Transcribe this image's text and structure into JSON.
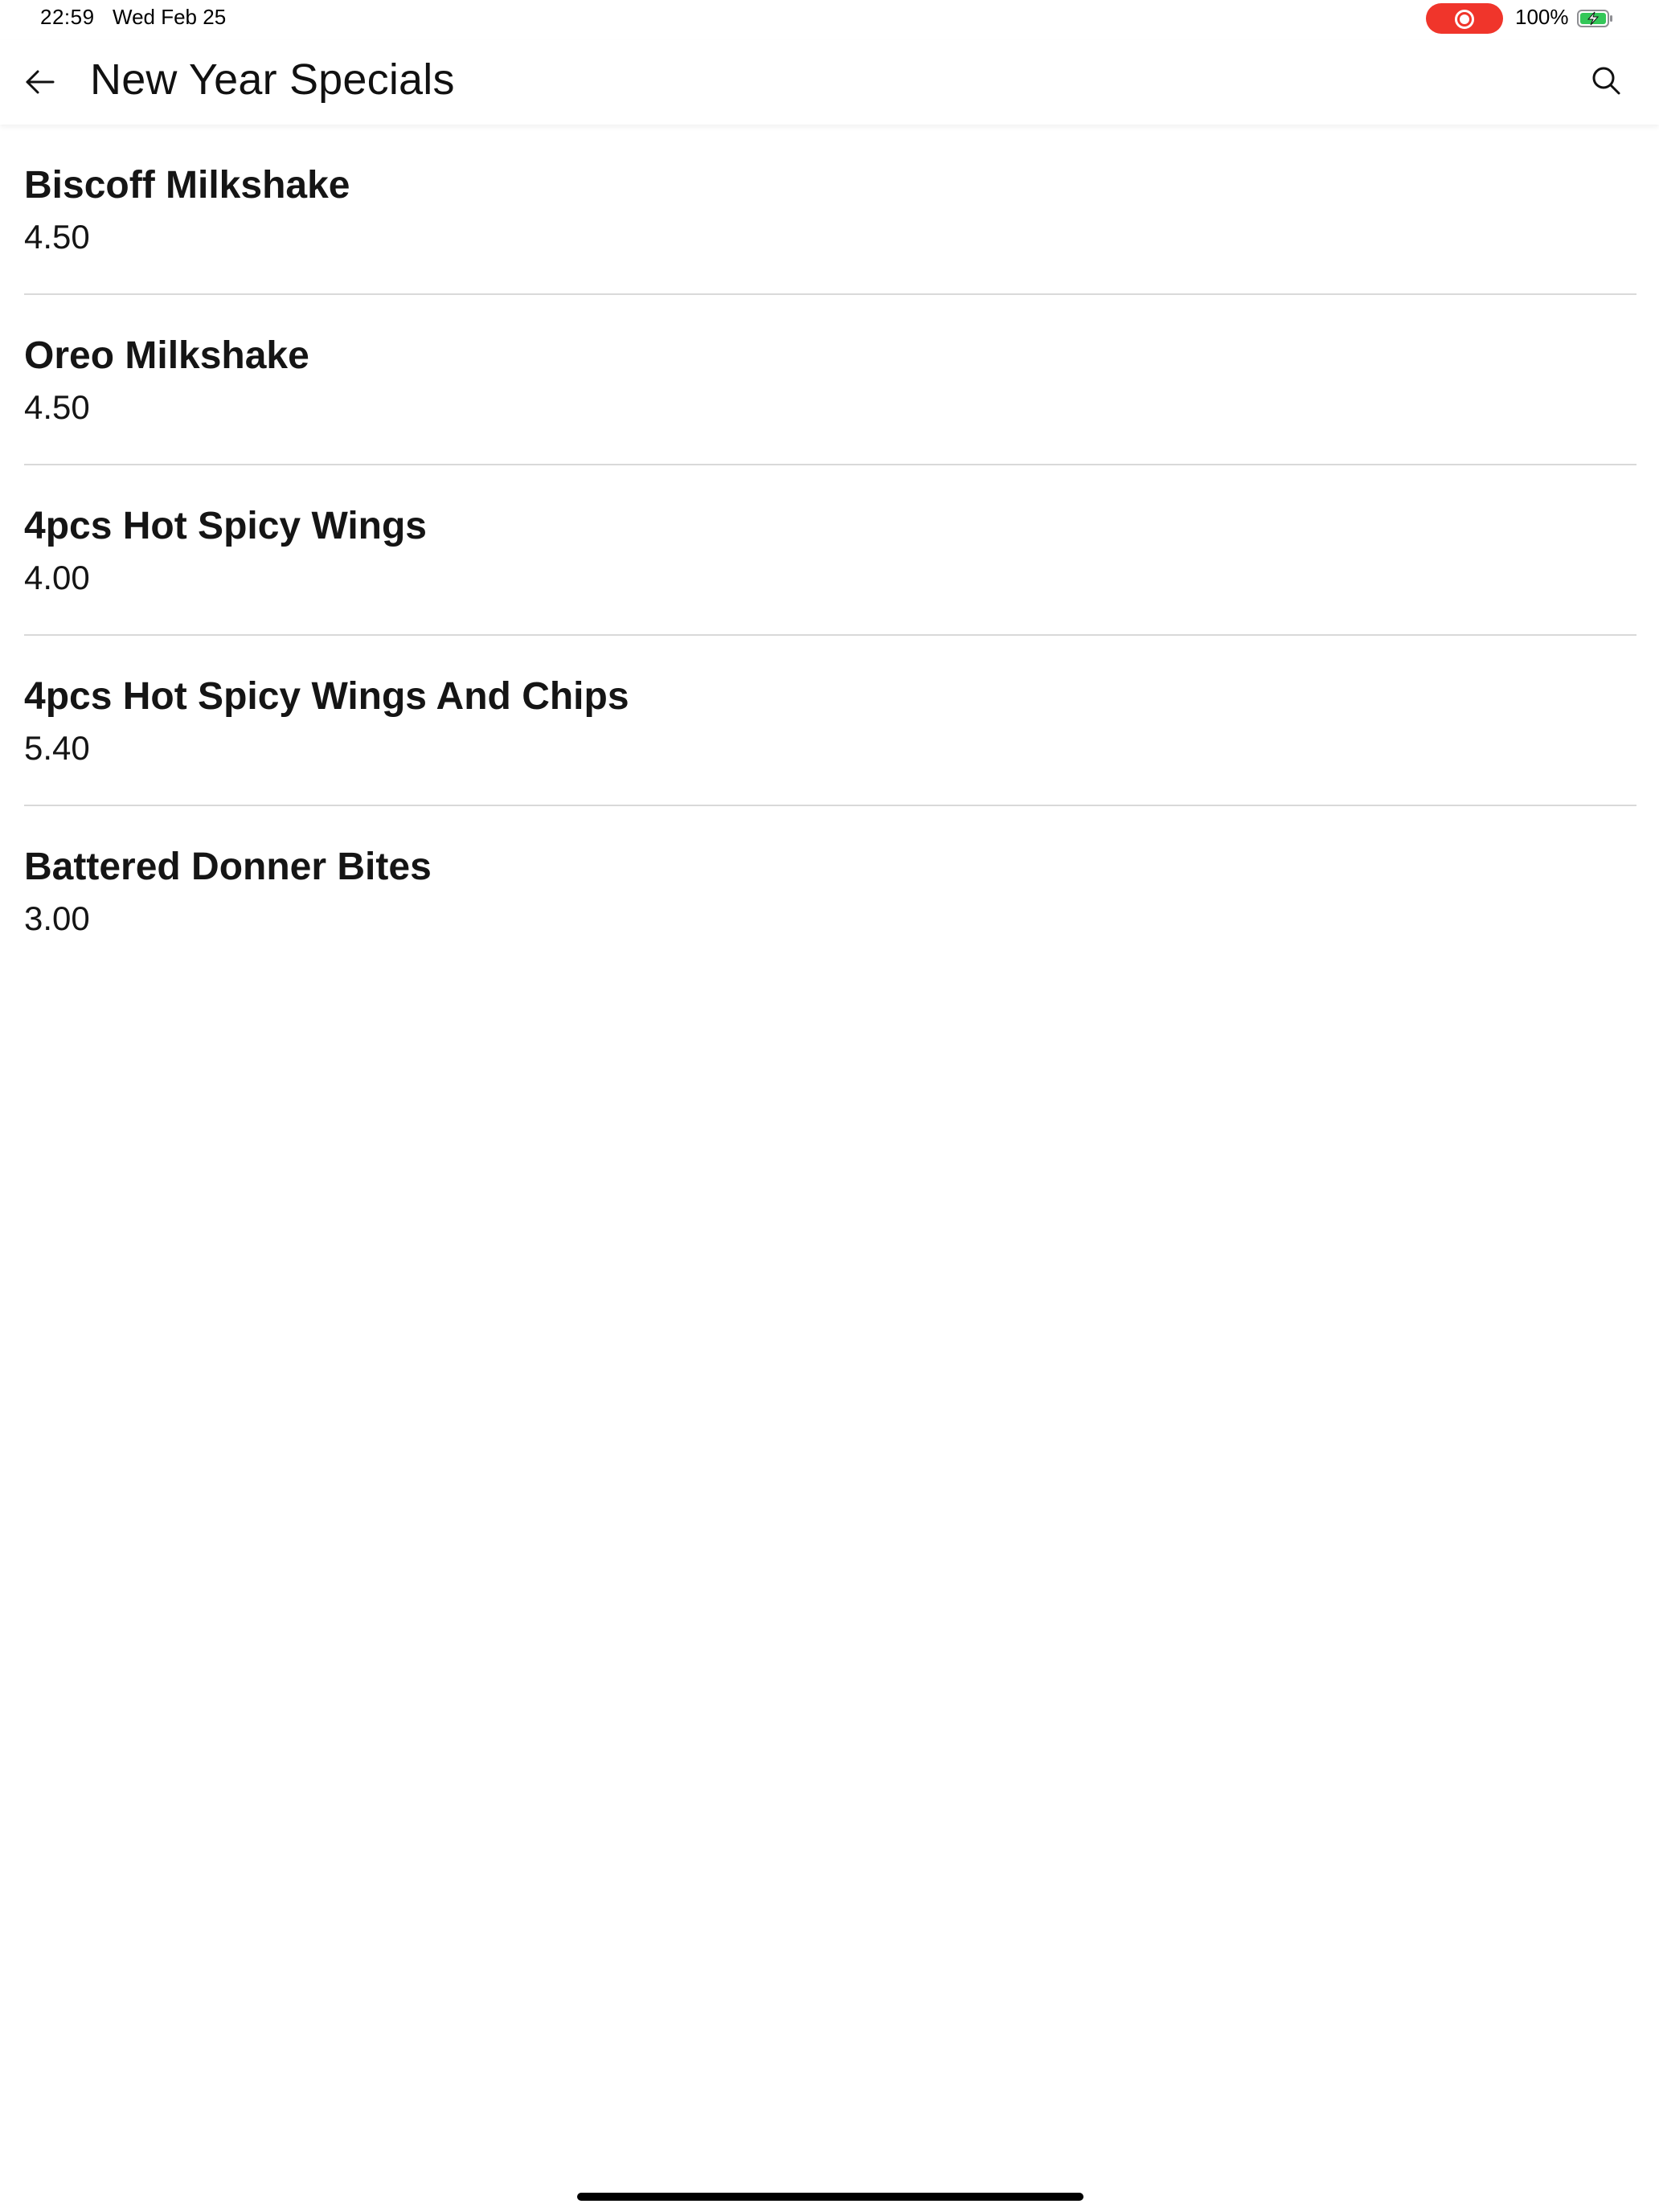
{
  "status_bar": {
    "time": "22:59",
    "date": "Wed Feb 25",
    "battery_percent": "100%",
    "battery_charging": true,
    "recording_indicator": true,
    "colors": {
      "recording": "#f0352b",
      "battery": "#34c759"
    }
  },
  "header": {
    "title": "New Year Specials",
    "back_icon": "arrow-left-icon",
    "search_icon": "search-icon"
  },
  "items": [
    {
      "name": "Biscoff Milkshake",
      "price": "4.50"
    },
    {
      "name": "Oreo Milkshake",
      "price": "4.50"
    },
    {
      "name": "4pcs Hot Spicy Wings",
      "price": "4.00"
    },
    {
      "name": "4pcs Hot Spicy Wings And Chips",
      "price": "5.40"
    },
    {
      "name": "Battered Donner Bites",
      "price": "3.00"
    }
  ]
}
